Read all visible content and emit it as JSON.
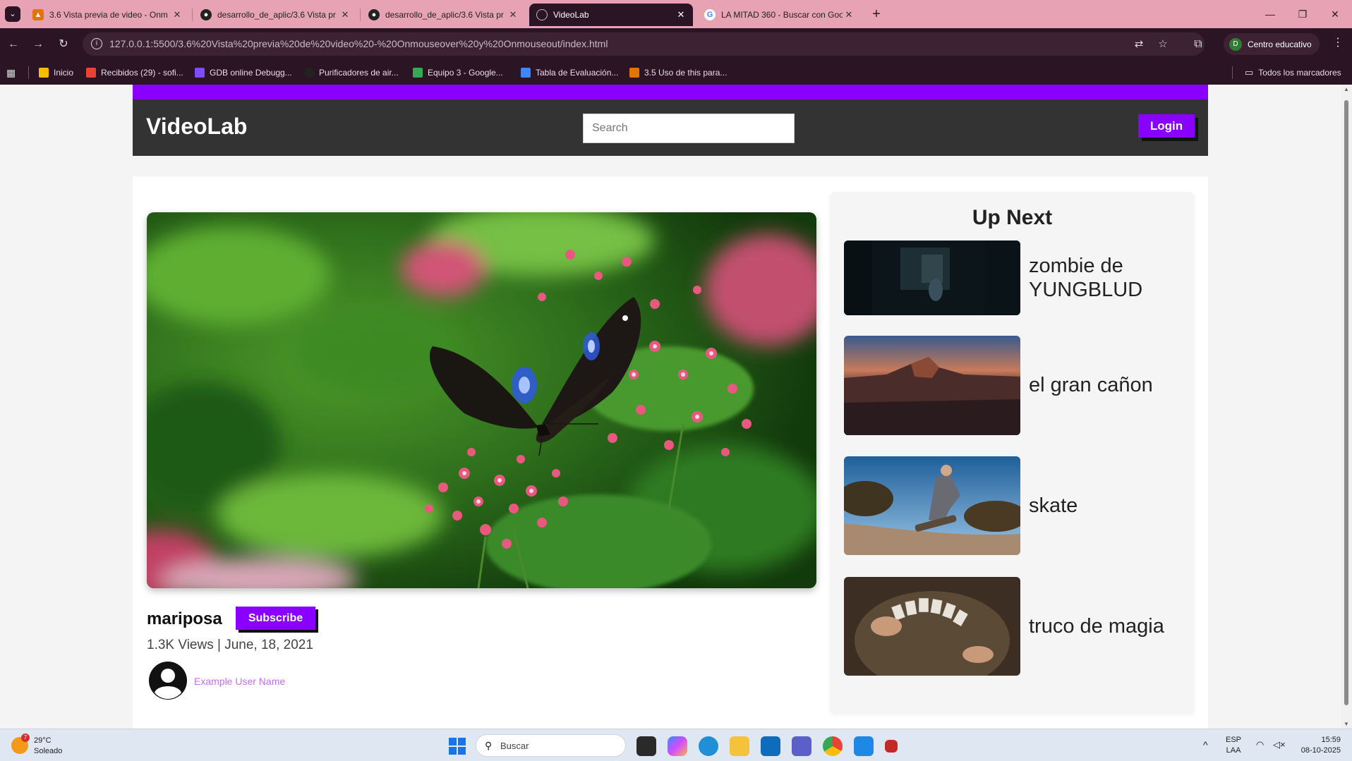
{
  "browser": {
    "tabs": [
      {
        "title": "3.6 Vista previa de video - Onm",
        "icon": "slides-icon",
        "color": "#e37400"
      },
      {
        "title": "desarrollo_de_aplic/3.6 Vista pr",
        "icon": "github-icon",
        "color": "#222222"
      },
      {
        "title": "desarrollo_de_aplic/3.6 Vista pr",
        "icon": "github-icon",
        "color": "#222222"
      },
      {
        "title": "VideoLab",
        "icon": "globe-icon",
        "color": "#888888",
        "active": true
      },
      {
        "title": "LA MITAD 360 - Buscar con Goo",
        "icon": "google-icon",
        "color": "#4285f4"
      }
    ],
    "url": "127.0.0.1:5500/3.6%20Vista%20previa%20de%20video%20-%20Onmouseover%20y%20Onmouseout/index.html",
    "profile_initial": "D",
    "profile_label": "Centro educativo",
    "bookmarks": [
      {
        "label": "Inicio",
        "color": "#fbbc04"
      },
      {
        "label": "Recibidos (29) - sofi...",
        "color": "#ea4335"
      },
      {
        "label": "GDB online Debugg...",
        "color": "#7c4dff"
      },
      {
        "label": "Purificadores de air...",
        "color": "#222222"
      },
      {
        "label": "Equipo 3 - Google...",
        "color": "#34a853"
      },
      {
        "label": "Tabla de Evaluación...",
        "color": "#4285f4"
      },
      {
        "label": "3.5 Uso de this para...",
        "color": "#e37400"
      }
    ],
    "all_bookmarks_label": "Todos los marcadores"
  },
  "site": {
    "brand": "VideoLab",
    "search_placeholder": "Search",
    "login_label": "Login",
    "accent": "#8a00ff",
    "header_bg": "#333333"
  },
  "video": {
    "title": "mariposa",
    "subscribe_label": "Subscribe",
    "info": "1.3K Views | June, 18, 2021",
    "user_name": "Example User Name"
  },
  "upnext": {
    "heading": "Up Next",
    "items": [
      {
        "title": "zombie de YUNGBLUD"
      },
      {
        "title": "el gran cañon"
      },
      {
        "title": "skate"
      },
      {
        "title": "truco de magia"
      }
    ]
  },
  "taskbar": {
    "temperature": "29°C",
    "weather": "Soleado",
    "weather_badge": "7",
    "search_label": "Buscar",
    "lang_top": "ESP",
    "lang_bottom": "LAA",
    "time": "15:59",
    "date": "08-10-2025"
  }
}
